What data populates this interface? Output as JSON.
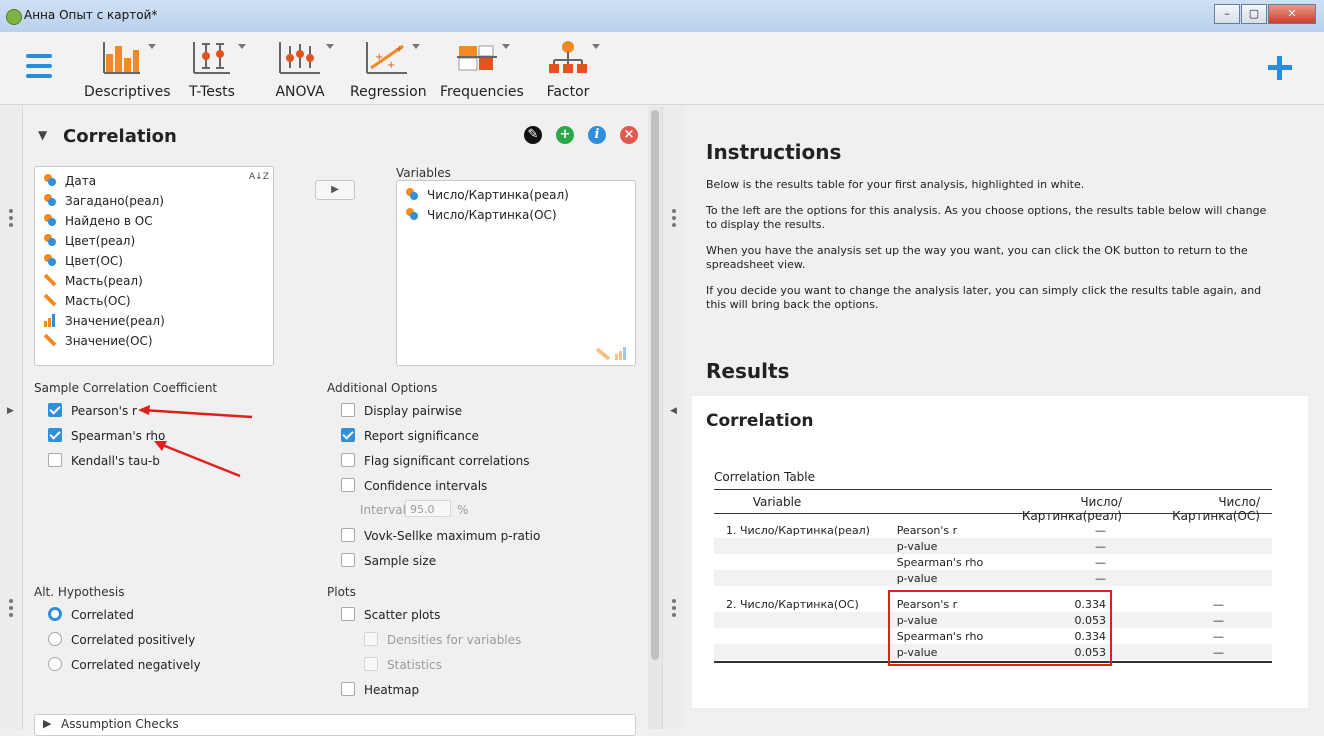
{
  "window": {
    "title": "Анна Опыт с картой*",
    "controls": [
      "–",
      "▢",
      "✕"
    ]
  },
  "toolbar": {
    "items": [
      {
        "label": "Descriptives",
        "icon": "descriptives-icon"
      },
      {
        "label": "T-Tests",
        "icon": "t-tests-icon"
      },
      {
        "label": "ANOVA",
        "icon": "anova-icon"
      },
      {
        "label": "Regression",
        "icon": "regression-icon"
      },
      {
        "label": "Frequencies",
        "icon": "frequencies-icon"
      },
      {
        "label": "Factor",
        "icon": "factor-icon"
      }
    ],
    "add_icon": "+"
  },
  "analysis": {
    "title": "Correlation",
    "source_variables": [
      {
        "name": "Дата",
        "type": "nominal"
      },
      {
        "name": "Загадано(реал)",
        "type": "nominal"
      },
      {
        "name": "Найдено в ОС",
        "type": "nominal"
      },
      {
        "name": "Цвет(реал)",
        "type": "nominal"
      },
      {
        "name": "Цвет(ОС)",
        "type": "nominal"
      },
      {
        "name": "Масть(реал)",
        "type": "continuous"
      },
      {
        "name": "Масть(ОС)",
        "type": "continuous"
      },
      {
        "name": "Значение(реал)",
        "type": "ordinal"
      },
      {
        "name": "Значение(ОС)",
        "type": "continuous"
      }
    ],
    "sort_icon": "A↓Z",
    "move_arrow": "▶",
    "variables_label": "Variables",
    "selected_variables": [
      "Число/Картинка(реал)",
      "Число/Картинка(ОС)"
    ],
    "coefficient_group": "Sample Correlation Coefficient",
    "coefficients": [
      {
        "label": "Pearson's r",
        "checked": true
      },
      {
        "label": "Spearman's rho",
        "checked": true
      },
      {
        "label": "Kendall's tau-b",
        "checked": false
      }
    ],
    "additional_group": "Additional Options",
    "additional": [
      {
        "label": "Display pairwise",
        "checked": false
      },
      {
        "label": "Report significance",
        "checked": true
      },
      {
        "label": "Flag significant correlations",
        "checked": false
      },
      {
        "label": "Confidence intervals",
        "checked": false
      }
    ],
    "interval_label": "Interval",
    "interval_value": "95.0",
    "interval_unit": "%",
    "additional2": [
      {
        "label": "Vovk-Sellke maximum p-ratio",
        "checked": false
      },
      {
        "label": "Sample size",
        "checked": false
      }
    ],
    "hypothesis_group": "Alt. Hypothesis",
    "hypotheses": [
      {
        "label": "Correlated",
        "selected": true
      },
      {
        "label": "Correlated positively",
        "selected": false
      },
      {
        "label": "Correlated negatively",
        "selected": false
      }
    ],
    "plots_group": "Plots",
    "plots": {
      "scatter": "Scatter plots",
      "densities": "Densities for variables",
      "statistics": "Statistics",
      "heatmap": "Heatmap"
    },
    "assumption_checks": "Assumption Checks"
  },
  "instructions": {
    "title": "Instructions",
    "paragraphs": [
      "Below is the results table for your first analysis, highlighted in white.",
      "To the left are the options for this analysis. As you choose options, the results table below will change to display the results.",
      "When you have the analysis set up the way you want, you can click the OK button to return to the spreadsheet view.",
      "If you decide you want to change the analysis later, you can simply click the results table again, and this will bring back the options."
    ]
  },
  "results": {
    "title": "Results",
    "subtitle": "Correlation",
    "table_title": "Correlation Table",
    "col_variable": "Variable",
    "col1": "Число/Картинка(реал)",
    "col2": "Число/Картинка(ОС)",
    "rows": [
      {
        "var": "1. Число/Картинка(реал)",
        "stat": "Pearson's r",
        "c1": "—",
        "c2": ""
      },
      {
        "var": "",
        "stat": "p-value",
        "c1": "—",
        "c2": ""
      },
      {
        "var": "",
        "stat": "Spearman's rho",
        "c1": "—",
        "c2": ""
      },
      {
        "var": "",
        "stat": "p-value",
        "c1": "—",
        "c2": ""
      },
      {
        "var": "2. Число/Картинка(ОС)",
        "stat": "Pearson's r",
        "c1": "0.334",
        "c2": "—"
      },
      {
        "var": "",
        "stat": "p-value",
        "c1": "0.053",
        "c2": "—"
      },
      {
        "var": "",
        "stat": "Spearman's rho",
        "c1": "0.334",
        "c2": "—"
      },
      {
        "var": "",
        "stat": "p-value",
        "c1": "0.053",
        "c2": "—"
      }
    ]
  },
  "colors": {
    "accent": "#2f8fdc",
    "annotation_red": "#e0201b"
  }
}
